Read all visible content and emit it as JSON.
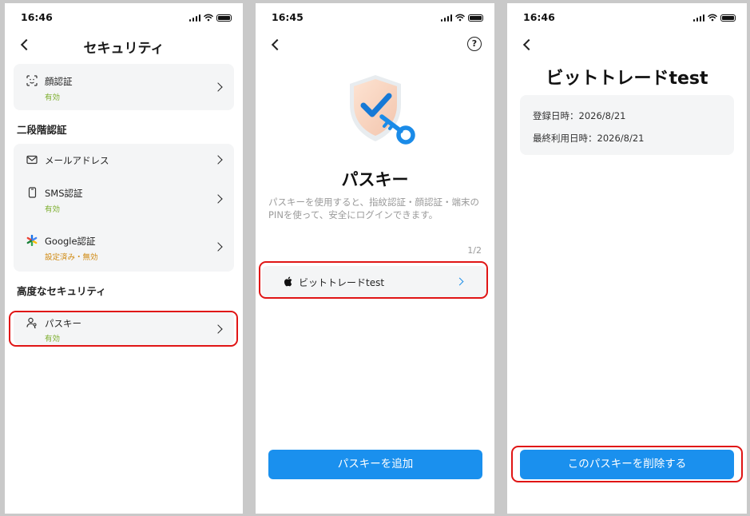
{
  "status": {
    "time_1": "16:46",
    "time_2": "16:45",
    "time_3": "16:46"
  },
  "screen1": {
    "title": "セキュリティ",
    "face": {
      "label": "顔認証",
      "status": "有効"
    },
    "section_2fa": "二段階認証",
    "mail": {
      "label": "メールアドレス"
    },
    "sms": {
      "label": "SMS認証",
      "status": "有効"
    },
    "google": {
      "label": "Google認証",
      "status": "設定済み・無効"
    },
    "section_advanced": "高度なセキュリティ",
    "passkey": {
      "label": "パスキー",
      "status": "有効"
    }
  },
  "screen2": {
    "help_glyph": "?",
    "title": "パスキー",
    "description": "パスキーを使用すると、指紋認証・顔認証・端末のPINを使って、安全にログインできます。",
    "count": "1/2",
    "item_label": "ビットトレードtest",
    "add_button": "パスキーを追加"
  },
  "screen3": {
    "title": "ビットトレードtest",
    "registered": "登録日時：2026/8/21",
    "last_used": "最終利用日時：2026/8/21",
    "delete_button": "このパスキーを削除する"
  },
  "colors": {
    "accent": "#1a90ee",
    "enabled_text": "#7cae2c",
    "highlight_border": "#e01515"
  },
  "icons": [
    "face-id-icon",
    "mail-icon",
    "phone-icon",
    "google-authenticator-icon",
    "user-key-icon",
    "chevron-right-icon",
    "back-icon",
    "help-icon",
    "shield-key-icon",
    "apple-icon"
  ]
}
